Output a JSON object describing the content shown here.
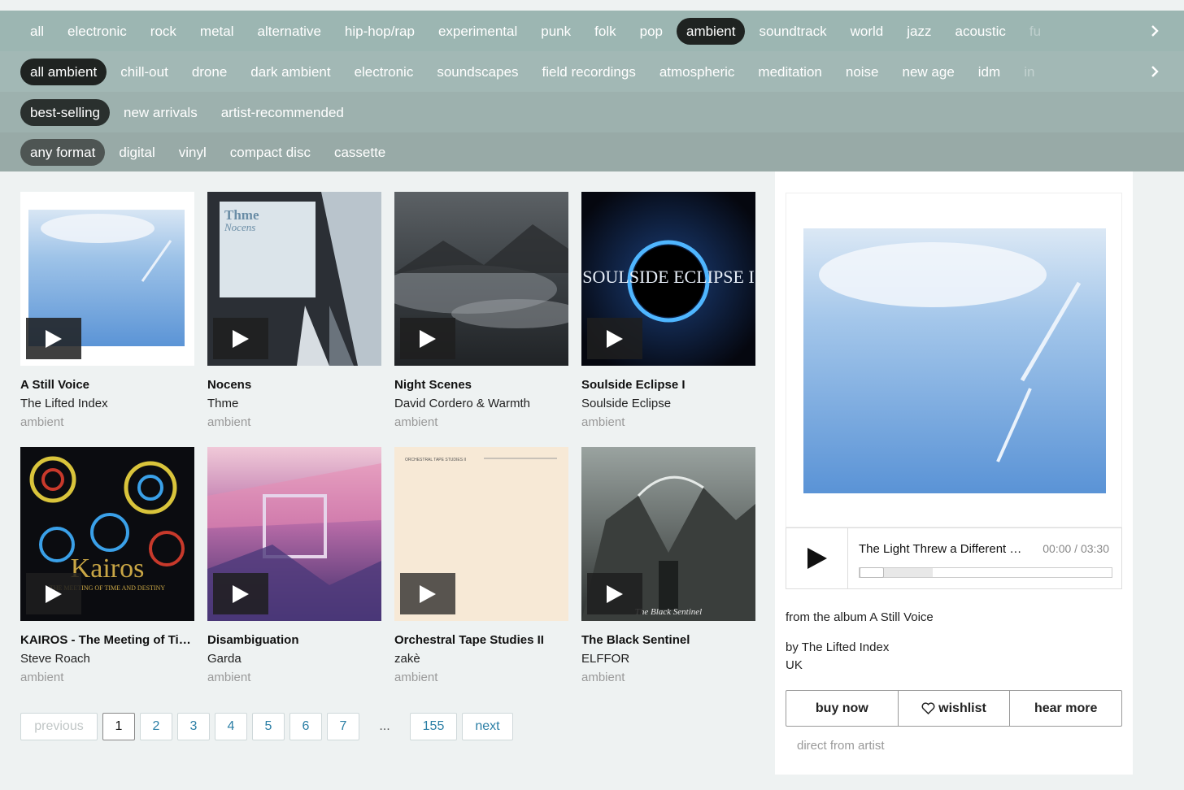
{
  "genre_tags": [
    "all",
    "electronic",
    "rock",
    "metal",
    "alternative",
    "hip-hop/rap",
    "experimental",
    "punk",
    "folk",
    "pop",
    "ambient",
    "soundtrack",
    "world",
    "jazz",
    "acoustic",
    "fu"
  ],
  "genre_selected": "ambient",
  "subgenre_tags": [
    "all ambient",
    "chill-out",
    "drone",
    "dark ambient",
    "electronic",
    "soundscapes",
    "field recordings",
    "atmospheric",
    "meditation",
    "noise",
    "new age",
    "idm",
    "in"
  ],
  "sort_tags": [
    "best-selling",
    "new arrivals",
    "artist-recommended"
  ],
  "format_tags": [
    "any format",
    "digital",
    "vinyl",
    "compact disc",
    "cassette"
  ],
  "albums": [
    {
      "title": "A Still Voice",
      "artist": "The Lifted Index",
      "genre": "ambient",
      "cover_text": ""
    },
    {
      "title": "Nocens",
      "artist": "Thme",
      "genre": "ambient",
      "cover_text": "Thme",
      "cover_sub": "Nocens"
    },
    {
      "title": "Night Scenes",
      "artist": "David Cordero & Warmth",
      "genre": "ambient",
      "cover_text": ""
    },
    {
      "title": "Soulside Eclipse I",
      "artist": "Soulside Eclipse",
      "genre": "ambient",
      "cover_text": "SOULSIDE ECLIPSE I"
    },
    {
      "title": "KAIROS - The Meeting of Time and Destiny",
      "artist": "Steve Roach",
      "genre": "ambient",
      "cover_text": "Kairos",
      "cover_sub": "THE MEETING OF TIME AND DESTINY"
    },
    {
      "title": "Disambiguation",
      "artist": "Garda",
      "genre": "ambient",
      "cover_text": ""
    },
    {
      "title": "Orchestral Tape Studies II",
      "artist": "zakè",
      "genre": "ambient",
      "cover_text": "ORCHESTRAL TAPE STUDIES II"
    },
    {
      "title": "The Black Sentinel",
      "artist": "ELFFOR",
      "genre": "ambient",
      "cover_text": "The Black Sentinel"
    }
  ],
  "pager": {
    "previous": "previous",
    "pages": [
      "1",
      "2",
      "3",
      "4",
      "5",
      "6",
      "7"
    ],
    "current": "1",
    "dots": "...",
    "last": "155",
    "next": "next"
  },
  "player": {
    "track": "The Light Threw a Different Shade",
    "time": "00:00 / 03:30",
    "progress": 0.0,
    "buffered": 0.29
  },
  "side": {
    "from_prefix": "from the album ",
    "album": "A Still Voice",
    "by_prefix": "by ",
    "artist": "The Lifted Index",
    "location": "UK",
    "buy": "buy now",
    "wishlist": "wishlist",
    "hear_more": "hear more",
    "direct": "direct from artist"
  },
  "icons": {
    "next_arrow": "chevron-right-icon",
    "play": "play-icon",
    "heart": "heart-icon"
  }
}
